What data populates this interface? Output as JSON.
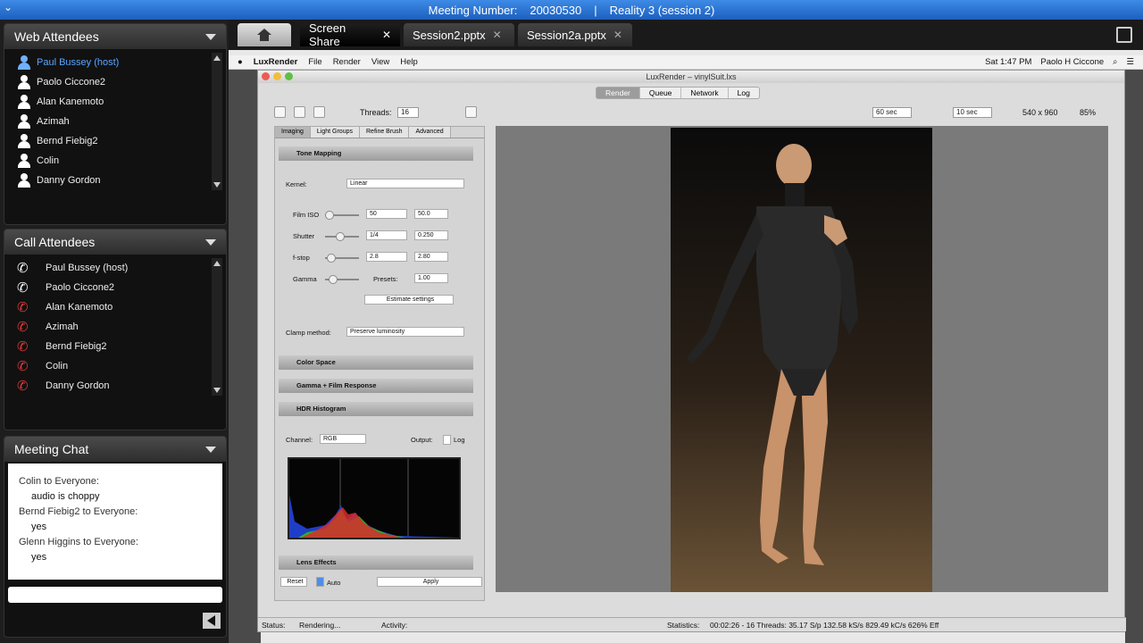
{
  "meeting": {
    "label": "Meeting Number:",
    "number": "20030530",
    "separator": "|",
    "session": "Reality 3 (session 2)"
  },
  "web_attendees": {
    "title": "Web Attendees",
    "items": [
      {
        "name": "Paul Bussey (host)"
      },
      {
        "name": "Paolo Ciccone2"
      },
      {
        "name": "Alan Kanemoto"
      },
      {
        "name": "Azimah"
      },
      {
        "name": "Bernd Fiebig2"
      },
      {
        "name": "Colin"
      },
      {
        "name": "Danny Gordon"
      }
    ]
  },
  "call_attendees": {
    "title": "Call Attendees",
    "items": [
      {
        "name": "Paul Bussey (host)"
      },
      {
        "name": "Paolo Ciccone2"
      },
      {
        "name": "Alan Kanemoto"
      },
      {
        "name": "Azimah"
      },
      {
        "name": "Bernd Fiebig2"
      },
      {
        "name": "Colin"
      },
      {
        "name": "Danny Gordon"
      }
    ]
  },
  "chat": {
    "title": "Meeting Chat",
    "messages": [
      {
        "from": "Colin to Everyone:",
        "text": "audio is choppy"
      },
      {
        "from": "Bernd Fiebig2 to Everyone:",
        "text": "yes"
      },
      {
        "from": "Glenn Higgins to Everyone:",
        "text": "yes"
      }
    ]
  },
  "tabs": [
    {
      "label": "Screen Share",
      "close": "✕"
    },
    {
      "label": "Session2.pptx",
      "close": "✕"
    },
    {
      "label": "Session2a.pptx",
      "close": "✕"
    }
  ],
  "mac_menu": {
    "app": "LuxRender",
    "items": [
      "File",
      "Render",
      "View",
      "Help"
    ],
    "clock": "Sat 1:47 PM",
    "user": "Paolo H Ciccone"
  },
  "lux": {
    "window_title": "LuxRender – vinylSuit.lxs",
    "tabs": [
      "Render",
      "Queue",
      "Network",
      "Log"
    ],
    "threads_label": "Threads:",
    "threads_value": "16",
    "time1": "60 sec",
    "time2": "10 sec",
    "resolution": "540 x 960",
    "zoom": "85%",
    "side_tabs": [
      "Imaging",
      "Light Groups",
      "Refine Brush",
      "Advanced"
    ],
    "tone_mapping": "Tone Mapping",
    "kernel_label": "Kernel:",
    "kernel_value": "Linear",
    "film_iso_label": "Film ISO",
    "film_iso_a": "50",
    "film_iso_b": "50.0",
    "shutter_label": "Shutter",
    "shutter_a": "1/4",
    "shutter_b": "0.250",
    "fstop_label": "f-stop",
    "fstop_a": "2.8",
    "fstop_b": "2.80",
    "gamma_label": "Gamma",
    "presets_label": "Presets:",
    "gamma_value": "1.00",
    "estimate": "Estimate settings",
    "clamp_label": "Clamp method:",
    "clamp_value": "Preserve luminosity",
    "color_space": "Color Space",
    "gamma_film": "Gamma + Film Response",
    "hdr_hist": "HDR Histogram",
    "channel_label": "Channel:",
    "channel_value": "RGB",
    "output_label": "Output:",
    "log_label": "Log",
    "lens_effects": "Lens Effects",
    "reset": "Reset",
    "auto": "Auto",
    "apply": "Apply",
    "status_label": "Status:",
    "status_value": "Rendering...",
    "activity_label": "Activity:",
    "statistics_label": "Statistics:",
    "statistics_value": "00:02:26 - 16 Threads: 35.17 S/p  132.58 kS/s  829.49 kC/s  626% Eff"
  }
}
